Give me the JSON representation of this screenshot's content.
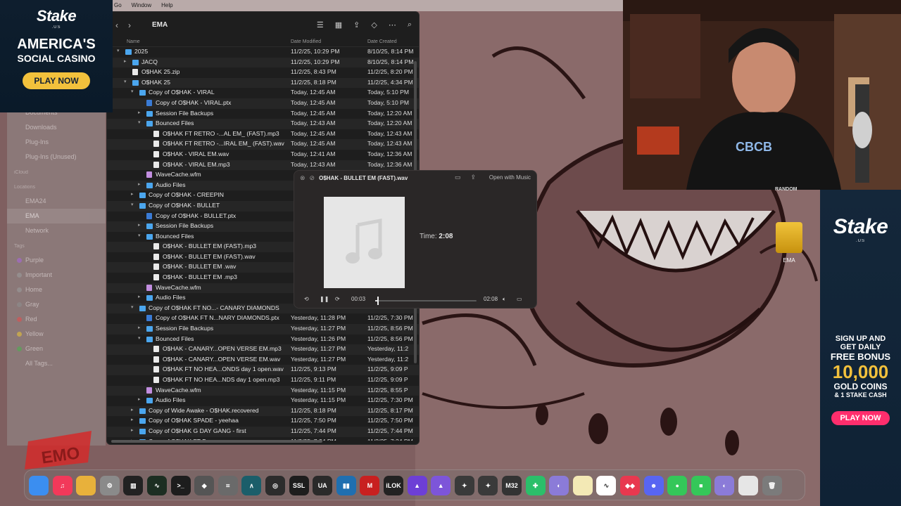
{
  "menubar": {
    "items": [
      "Go",
      "Window",
      "Help"
    ]
  },
  "sidebar": {
    "items": [
      {
        "label": "Documents",
        "section": false
      },
      {
        "label": "Downloads",
        "section": false
      },
      {
        "label": "Plug-Ins",
        "section": false
      },
      {
        "label": "Plug-Ins (Unused)",
        "section": false
      },
      {
        "label": "iCloud",
        "section": true
      },
      {
        "label": "Locations",
        "section": true
      },
      {
        "label": "EMA24",
        "section": false
      },
      {
        "label": "EMA",
        "section": false
      },
      {
        "label": "Network",
        "section": false
      },
      {
        "label": "Tags",
        "section": true
      },
      {
        "label": "Purple",
        "section": false,
        "color": "#a866d9"
      },
      {
        "label": "Important",
        "section": false,
        "color": "#9b9b9b"
      },
      {
        "label": "Home",
        "section": false,
        "color": "#9b9b9b"
      },
      {
        "label": "Gray",
        "section": false,
        "color": "#8e8e8e"
      },
      {
        "label": "Red",
        "section": false,
        "color": "#e05050"
      },
      {
        "label": "Yellow",
        "section": false,
        "color": "#e6c23a"
      },
      {
        "label": "Green",
        "section": false,
        "color": "#4cb050"
      },
      {
        "label": "All Tags...",
        "section": false
      }
    ]
  },
  "finder": {
    "title": "EMA",
    "columns": {
      "name": "Name",
      "modified": "Date Modified",
      "created": "Date Created"
    },
    "rows": [
      {
        "name": "2025",
        "indent": 0,
        "kind": "folder",
        "disc": "open",
        "dm": "11/2/25, 10:29 PM",
        "dc": "8/10/25, 8:14 PM"
      },
      {
        "name": "JACQ",
        "indent": 1,
        "kind": "folder",
        "disc": "closed",
        "dm": "11/2/25, 10:29 PM",
        "dc": "8/10/25, 8:14 PM"
      },
      {
        "name": "O$HAK 25.zip",
        "indent": 1,
        "kind": "file",
        "disc": "",
        "dm": "11/2/25, 8:43 PM",
        "dc": "11/2/25, 8:20 PM"
      },
      {
        "name": "O$HAK 25",
        "indent": 1,
        "kind": "folder",
        "disc": "open",
        "dm": "11/2/25, 8:18 PM",
        "dc": "11/2/25, 4:34 PM"
      },
      {
        "name": "Copy of O$HAK - VIRAL",
        "indent": 2,
        "kind": "folder",
        "disc": "open",
        "dm": "Today, 12:45 AM",
        "dc": "Today, 5:10 PM"
      },
      {
        "name": "Copy of O$HAK - VIRAL.ptx",
        "indent": 3,
        "kind": "ptx",
        "disc": "",
        "dm": "Today, 12:45 AM",
        "dc": "Today, 5:10 PM"
      },
      {
        "name": "Session File Backups",
        "indent": 3,
        "kind": "folder",
        "disc": "closed",
        "dm": "Today, 12:45 AM",
        "dc": "Today, 12:20 AM"
      },
      {
        "name": "Bounced Files",
        "indent": 3,
        "kind": "folder",
        "disc": "open",
        "dm": "Today, 12:43 AM",
        "dc": "Today, 12:20 AM"
      },
      {
        "name": "O$HAK FT RETRO -...AL EM_ (FAST).mp3",
        "indent": 4,
        "kind": "file",
        "disc": "",
        "dm": "Today, 12:45 AM",
        "dc": "Today, 12:43 AM"
      },
      {
        "name": "O$HAK FT RETRO -...IRAL EM_ (FAST).wav",
        "indent": 4,
        "kind": "file",
        "disc": "",
        "dm": "Today, 12:45 AM",
        "dc": "Today, 12:43 AM"
      },
      {
        "name": "O$HAK - VIRAL EM.wav",
        "indent": 4,
        "kind": "file",
        "disc": "",
        "dm": "Today, 12:41 AM",
        "dc": "Today, 12:36 AM"
      },
      {
        "name": "O$HAK - VIRAL EM.mp3",
        "indent": 4,
        "kind": "file",
        "disc": "",
        "dm": "Today, 12:43 AM",
        "dc": "Today, 12:36 AM"
      },
      {
        "name": "WaveCache.wfm",
        "indent": 3,
        "kind": "wave",
        "disc": "",
        "dm": "",
        "dc": ""
      },
      {
        "name": "Audio Files",
        "indent": 3,
        "kind": "folder",
        "disc": "closed",
        "dm": "",
        "dc": ""
      },
      {
        "name": "Copy of O$HAK - CREEPIN",
        "indent": 2,
        "kind": "folder",
        "disc": "closed",
        "dm": "",
        "dc": ""
      },
      {
        "name": "Copy of O$HAK - BULLET",
        "indent": 2,
        "kind": "folder",
        "disc": "open",
        "dm": "",
        "dc": ""
      },
      {
        "name": "Copy of O$HAK - BULLET.ptx",
        "indent": 3,
        "kind": "ptx",
        "disc": "",
        "dm": "",
        "dc": ""
      },
      {
        "name": "Session File Backups",
        "indent": 3,
        "kind": "folder",
        "disc": "closed",
        "dm": "",
        "dc": ""
      },
      {
        "name": "Bounced Files",
        "indent": 3,
        "kind": "folder",
        "disc": "open",
        "dm": "",
        "dc": ""
      },
      {
        "name": "O$HAK - BULLET EM (FAST).mp3",
        "indent": 4,
        "kind": "file",
        "disc": "",
        "dm": "",
        "dc": ""
      },
      {
        "name": "O$HAK - BULLET EM (FAST).wav",
        "indent": 4,
        "kind": "file",
        "disc": "",
        "dm": "",
        "dc": ""
      },
      {
        "name": "O$HAK - BULLET EM .wav",
        "indent": 4,
        "kind": "file",
        "disc": "",
        "dm": "",
        "dc": ""
      },
      {
        "name": "O$HAK - BULLET EM .mp3",
        "indent": 4,
        "kind": "file",
        "disc": "",
        "dm": "",
        "dc": ""
      },
      {
        "name": "WaveCache.wfm",
        "indent": 3,
        "kind": "wave",
        "disc": "",
        "dm": "",
        "dc": ""
      },
      {
        "name": "Audio Files",
        "indent": 3,
        "kind": "folder",
        "disc": "closed",
        "dm": "",
        "dc": ""
      },
      {
        "name": "Copy of O$HAK FT NO...- CANARY DIAMONDS",
        "indent": 2,
        "kind": "folder",
        "disc": "open",
        "dm": "",
        "dc": ""
      },
      {
        "name": "Copy of O$HAK FT N...NARY DIAMONDS.ptx",
        "indent": 3,
        "kind": "ptx",
        "disc": "",
        "dm": "Yesterday, 11:28 PM",
        "dc": "11/2/25, 7:30 PM"
      },
      {
        "name": "Session File Backups",
        "indent": 3,
        "kind": "folder",
        "disc": "closed",
        "dm": "Yesterday, 11:27 PM",
        "dc": "11/2/25, 8:56 PM"
      },
      {
        "name": "Bounced Files",
        "indent": 3,
        "kind": "folder",
        "disc": "open",
        "dm": "Yesterday, 11:26 PM",
        "dc": "11/2/25, 8:56 PM"
      },
      {
        "name": "O$HAK - CANARY...OPEN VERSE EM.mp3",
        "indent": 4,
        "kind": "file",
        "disc": "",
        "dm": "Yesterday, 11:27 PM",
        "dc": "Yesterday, 11:2"
      },
      {
        "name": "O$HAK - CANARY...OPEN VERSE EM.wav",
        "indent": 4,
        "kind": "file",
        "disc": "",
        "dm": "Yesterday, 11:27 PM",
        "dc": "Yesterday, 11:2"
      },
      {
        "name": "O$HAK FT NO HEA...ONDS day 1 open.wav",
        "indent": 4,
        "kind": "file",
        "disc": "",
        "dm": "11/2/25, 9:13 PM",
        "dc": "11/2/25, 9:09 P"
      },
      {
        "name": "O$HAK FT NO HEA...NDS day 1 open.mp3",
        "indent": 4,
        "kind": "file",
        "disc": "",
        "dm": "11/2/25, 9:11 PM",
        "dc": "11/2/25, 9:09 P"
      },
      {
        "name": "WaveCache.wfm",
        "indent": 3,
        "kind": "wave",
        "disc": "",
        "dm": "Yesterday, 11:15 PM",
        "dc": "11/2/25, 8:55 P"
      },
      {
        "name": "Audio Files",
        "indent": 3,
        "kind": "folder",
        "disc": "closed",
        "dm": "Yesterday, 11:15 PM",
        "dc": "11/2/25, 7:30 PM"
      },
      {
        "name": "Copy of Wide Awake - O$HAK.recovered",
        "indent": 2,
        "kind": "folder",
        "disc": "closed",
        "dm": "11/2/25, 8:18 PM",
        "dc": "11/2/25, 8:17 PM"
      },
      {
        "name": "Copy of O$HAK SPADE - yeehaa",
        "indent": 2,
        "kind": "folder",
        "disc": "closed",
        "dm": "11/2/25, 7:50 PM",
        "dc": "11/2/25, 7:50 PM"
      },
      {
        "name": "Copy of O$HAK G DAY GANG - first",
        "indent": 2,
        "kind": "folder",
        "disc": "closed",
        "dm": "11/2/25, 7:44 PM",
        "dc": "11/2/25, 7:44 PM"
      },
      {
        "name": "Copy of O$HAK FT B...",
        "indent": 2,
        "kind": "folder",
        "disc": "closed",
        "dm": "11/2/25, 7:24 PM",
        "dc": "11/2/25, 7:24 PM"
      }
    ]
  },
  "quicklook": {
    "title": "O$HAK - BULLET EM (FAST).wav",
    "open_with": "Open with Music",
    "time_label": "Time:",
    "time_value": "2:08",
    "elapsed": "00:03",
    "duration": "02:08",
    "progress_fraction": 0.023
  },
  "desktop": {
    "drive_label": "EMA",
    "random_label": "RANDOM"
  },
  "ad_left": {
    "brand": "Stake",
    "brand_sub": ".US",
    "line1": "AMERICA'S",
    "line2": "SOCIAL CASINO",
    "cta": "PLAY NOW"
  },
  "ad_right": {
    "brand": "Stake",
    "brand_sub": ".US",
    "line1": "SIGN UP AND",
    "line2": "GET DAILY",
    "line3": "FREE BONUS",
    "amount": "10,000",
    "line4": "GOLD COINS",
    "line5": "& 1 STAKE CASH",
    "cta": "PLAY NOW"
  },
  "watermark": {
    "text": "EMO"
  },
  "dock": {
    "apps": [
      {
        "name": "finder-icon",
        "label": "",
        "color": "#3b8ef0"
      },
      {
        "name": "music-icon",
        "label": "♫",
        "color": "#f2395a"
      },
      {
        "name": "chrome-icon",
        "label": "",
        "color": "#e8b13b"
      },
      {
        "name": "settings-icon",
        "label": "⚙",
        "color": "#8a8a8a"
      },
      {
        "name": "piano-icon",
        "label": "▥",
        "color": "#222222"
      },
      {
        "name": "activity-icon",
        "label": "∿",
        "color": "#1c2e22"
      },
      {
        "name": "terminal-icon",
        "label": ">_",
        "color": "#1d1d1d"
      },
      {
        "name": "logic-icon",
        "label": "◆",
        "color": "#555555"
      },
      {
        "name": "crop-icon",
        "label": "⌗",
        "color": "#6a6a6a"
      },
      {
        "name": "wave-app-icon",
        "label": "∧",
        "color": "#1b5e6a"
      },
      {
        "name": "pt-icon",
        "label": "◎",
        "color": "#2c2c2c"
      },
      {
        "name": "ssl-icon",
        "label": "SSL",
        "color": "#1d1d1d"
      },
      {
        "name": "ua-icon",
        "label": "UA",
        "color": "#2a2a2a"
      },
      {
        "name": "waves-icon",
        "label": "▮▮",
        "color": "#1f6fb0"
      },
      {
        "name": "m-icon",
        "label": "M",
        "color": "#c82020"
      },
      {
        "name": "ilok-icon",
        "label": "iLOK",
        "color": "#222222"
      },
      {
        "name": "a-icon",
        "label": "▲",
        "color": "#6d3fd6"
      },
      {
        "name": "a2-icon",
        "label": "▲",
        "color": "#7d55d9"
      },
      {
        "name": "plugin-icon",
        "label": "✦",
        "color": "#3a3a3a"
      },
      {
        "name": "plugin2-icon",
        "label": "✦",
        "color": "#3a3a3a"
      },
      {
        "name": "m32-icon",
        "label": "M32",
        "color": "#333333"
      },
      {
        "name": "ghost-icon",
        "label": "✚",
        "color": "#2bbf6a"
      },
      {
        "name": "screen-icon",
        "label": "◐",
        "color": "#8b7bd8"
      },
      {
        "name": "notes-icon",
        "label": "",
        "color": "#f3e9b5"
      },
      {
        "name": "freeform-icon",
        "label": "∿",
        "color": "#ffffff"
      },
      {
        "name": "shortcut-icon",
        "label": "◆◆",
        "color": "#e8384f"
      },
      {
        "name": "discord-icon",
        "label": "☻",
        "color": "#5865f2"
      },
      {
        "name": "messages-icon",
        "label": "●",
        "color": "#34c759"
      },
      {
        "name": "facetime-icon",
        "label": "■",
        "color": "#34c759"
      },
      {
        "name": "screen2-icon",
        "label": "◐",
        "color": "#8b7bd8"
      },
      {
        "name": "downloads-icon",
        "label": "",
        "color": "#e6e6e6"
      },
      {
        "name": "trash-icon",
        "label": "🗑",
        "color": "#7b7b7b"
      }
    ]
  }
}
